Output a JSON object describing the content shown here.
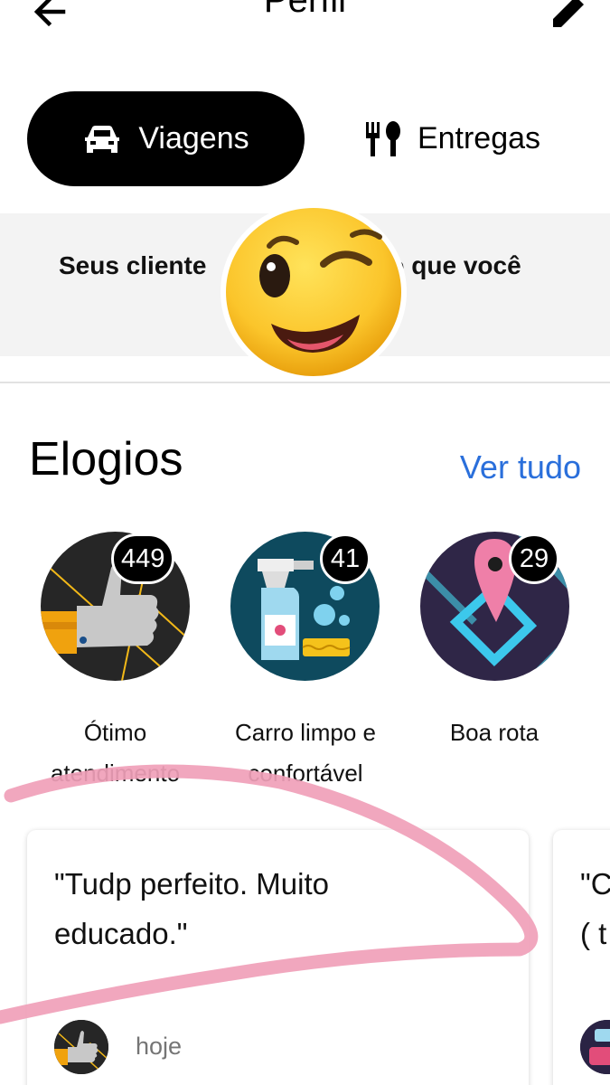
{
  "header": {
    "title": "Perfil",
    "back_icon": "arrow-left-icon",
    "edit_icon": "pencil-icon"
  },
  "tabs": [
    {
      "label": "Viagens",
      "icon": "car-icon",
      "active": true
    },
    {
      "label": "Entregas",
      "icon": "fork-spoon-icon",
      "active": false
    }
  ],
  "banner": {
    "text_left": "Seus cliente",
    "text_right": "o que você"
  },
  "overlays": {
    "sticker": "winking-face-emoji",
    "annotation": "pink-freehand-stroke",
    "annotation_color": "#f0a0b8"
  },
  "compliments": {
    "title": "Elogios",
    "see_all": "Ver tudo",
    "items": [
      {
        "label_line1": "Ótimo",
        "label_line2": "atendimento",
        "count": "449",
        "icon": "thumbs-up-icon"
      },
      {
        "label_line1": "Carro limpo e",
        "label_line2": "confortável",
        "count": "41",
        "icon": "spray-bottle-icon"
      },
      {
        "label_line1": "Boa rota",
        "label_line2": "",
        "count": "29",
        "icon": "map-pin-icon"
      }
    ]
  },
  "reviews": [
    {
      "quote_line1": "\"Tudp perfeito. Muito",
      "quote_line2": "educado.\"",
      "time": "hoje"
    },
    {
      "quote_line1": "\"C",
      "quote_line2": "( t"
    }
  ],
  "colors": {
    "accent_blue": "#2a6fdb",
    "tab_active_bg": "#000000",
    "banner_bg": "#f3f3f3"
  }
}
